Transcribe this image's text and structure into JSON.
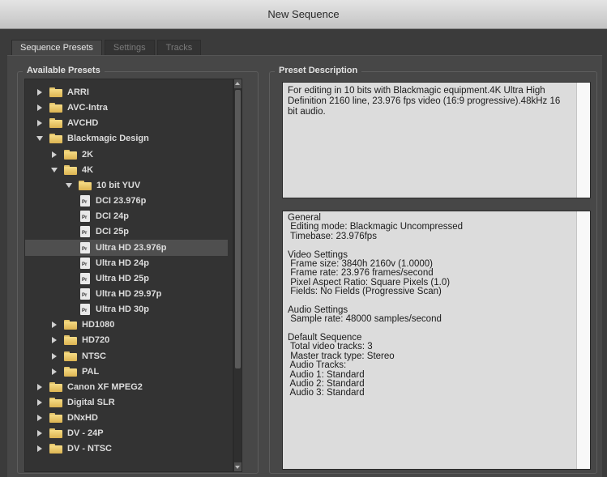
{
  "window": {
    "title": "New Sequence"
  },
  "tabs": [
    {
      "label": "Sequence Presets",
      "active": true
    },
    {
      "label": "Settings",
      "active": false
    },
    {
      "label": "Tracks",
      "active": false
    }
  ],
  "presets": {
    "label": "Available Presets",
    "tree": [
      {
        "label": "ARRI",
        "type": "folder",
        "level": 0,
        "expanded": false
      },
      {
        "label": "AVC-Intra",
        "type": "folder",
        "level": 0,
        "expanded": false
      },
      {
        "label": "AVCHD",
        "type": "folder",
        "level": 0,
        "expanded": false
      },
      {
        "label": "Blackmagic Design",
        "type": "folder",
        "level": 0,
        "expanded": true
      },
      {
        "label": "2K",
        "type": "folder",
        "level": 1,
        "expanded": false
      },
      {
        "label": "4K",
        "type": "folder",
        "level": 1,
        "expanded": true
      },
      {
        "label": "10 bit YUV",
        "type": "folder",
        "level": 2,
        "expanded": true
      },
      {
        "label": "DCI 23.976p",
        "type": "file",
        "level": 3
      },
      {
        "label": "DCI 24p",
        "type": "file",
        "level": 3
      },
      {
        "label": "DCI 25p",
        "type": "file",
        "level": 3
      },
      {
        "label": "Ultra HD 23.976p",
        "type": "file",
        "level": 3,
        "selected": true
      },
      {
        "label": "Ultra HD 24p",
        "type": "file",
        "level": 3
      },
      {
        "label": "Ultra HD 25p",
        "type": "file",
        "level": 3
      },
      {
        "label": "Ultra HD 29.97p",
        "type": "file",
        "level": 3
      },
      {
        "label": "Ultra HD 30p",
        "type": "file",
        "level": 3
      },
      {
        "label": "HD1080",
        "type": "folder",
        "level": 1,
        "expanded": false
      },
      {
        "label": "HD720",
        "type": "folder",
        "level": 1,
        "expanded": false
      },
      {
        "label": "NTSC",
        "type": "folder",
        "level": 1,
        "expanded": false
      },
      {
        "label": "PAL",
        "type": "folder",
        "level": 1,
        "expanded": false
      },
      {
        "label": "Canon XF MPEG2",
        "type": "folder",
        "level": 0,
        "expanded": false
      },
      {
        "label": "Digital SLR",
        "type": "folder",
        "level": 0,
        "expanded": false
      },
      {
        "label": "DNxHD",
        "type": "folder",
        "level": 0,
        "expanded": false
      },
      {
        "label": "DV - 24P",
        "type": "folder",
        "level": 0,
        "expanded": false
      },
      {
        "label": "DV - NTSC",
        "type": "folder",
        "level": 0,
        "expanded": false
      }
    ],
    "file_icon_text": "Pr"
  },
  "description": {
    "label": "Preset Description",
    "text": "For editing in 10 bits with Blackmagic equipment.4K Ultra High Definition 2160 line, 23.976 fps video (16:9 progressive).48kHz 16 bit audio."
  },
  "details": {
    "lines": [
      "General",
      " Editing mode: Blackmagic Uncompressed",
      " Timebase: 23.976fps",
      "",
      "Video Settings",
      " Frame size: 3840h 2160v (1.0000)",
      " Frame rate: 23.976 frames/second",
      " Pixel Aspect Ratio: Square Pixels (1.0)",
      " Fields: No Fields (Progressive Scan)",
      "",
      "Audio Settings",
      " Sample rate: 48000 samples/second",
      "",
      "Default Sequence",
      " Total video tracks: 3",
      " Master track type: Stereo",
      " Audio Tracks:",
      " Audio 1: Standard",
      " Audio 2: Standard",
      " Audio 3: Standard"
    ]
  }
}
